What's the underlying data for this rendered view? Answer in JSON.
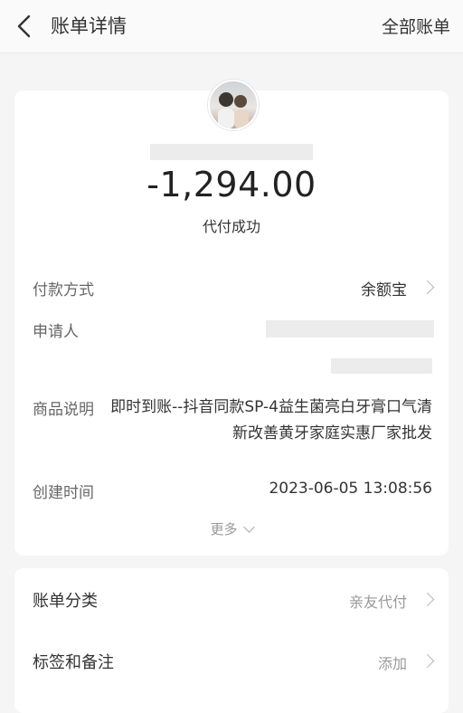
{
  "header": {
    "title": "账单详情",
    "right_link": "全部账单"
  },
  "summary": {
    "amount": "-1,294.00",
    "status": "代付成功"
  },
  "details": {
    "payment_method_label": "付款方式",
    "payment_method_value": "余额宝",
    "applicant_label": "申请人",
    "product_desc_label": "商品说明",
    "product_desc_value": "即时到账--抖音同款SP-4益生菌亮白牙膏口气清新改善黄牙家庭实惠厂家批发",
    "created_time_label": "创建时间",
    "created_time_value": "2023-06-05 13:08:56",
    "more_label": "更多"
  },
  "extra": {
    "category_label": "账单分类",
    "category_value": "亲友代付",
    "tags_label": "标签和备注",
    "tags_value": "添加"
  },
  "colors": {
    "page_bg": "#f5f5f5",
    "card_bg": "#ffffff",
    "redaction": "#ececec"
  }
}
